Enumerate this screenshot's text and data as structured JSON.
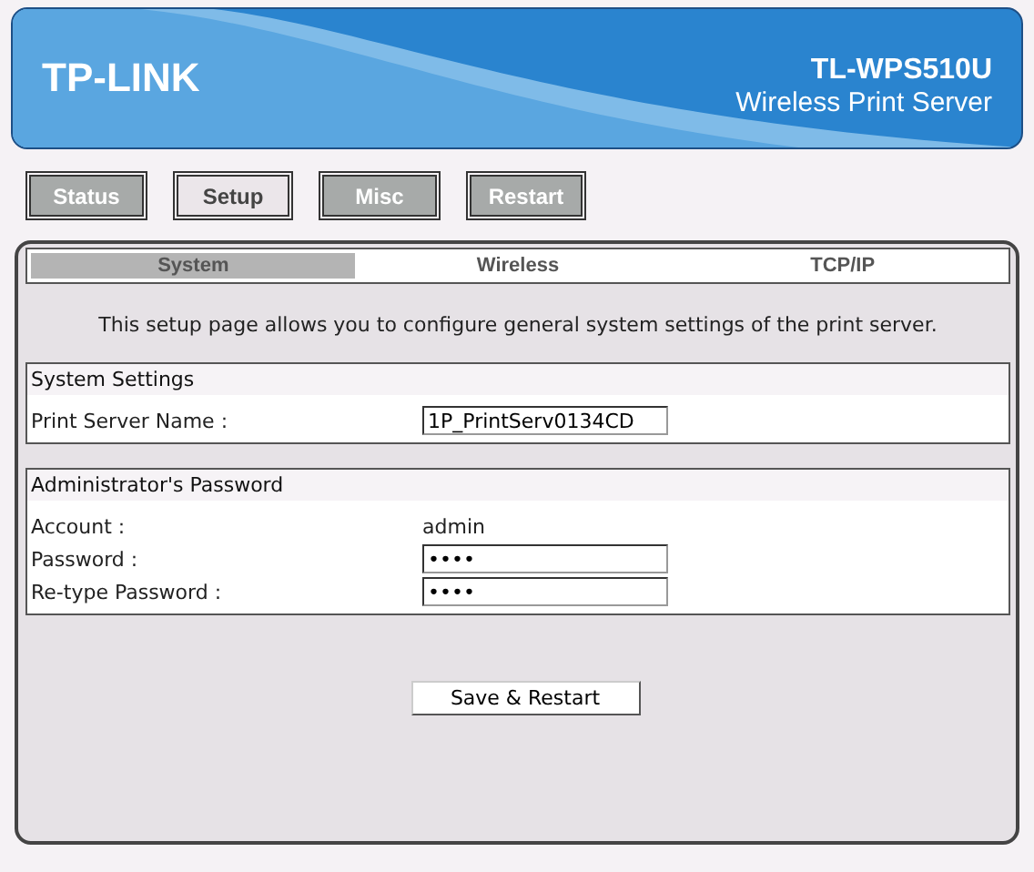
{
  "header": {
    "logo": "TP-LINK",
    "model": "TL-WPS510U",
    "subtitle": "Wireless Print Server"
  },
  "nav": [
    {
      "label": "Status",
      "selected": false
    },
    {
      "label": "Setup",
      "selected": true
    },
    {
      "label": "Misc",
      "selected": false
    },
    {
      "label": "Restart",
      "selected": false
    }
  ],
  "tabs": [
    {
      "label": "System",
      "selected": true
    },
    {
      "label": "Wireless",
      "selected": false
    },
    {
      "label": "TCP/IP",
      "selected": false
    }
  ],
  "description": "This setup page allows you to configure general system settings of the print server.",
  "sections": [
    {
      "title": "System Settings",
      "rows": [
        {
          "kind": "input",
          "label": "Print Server Name :",
          "value": "1P_PrintServ0134CD"
        }
      ]
    },
    {
      "title": "Administrator's Password",
      "rows": [
        {
          "kind": "text",
          "label": "Account :",
          "value": "admin"
        },
        {
          "kind": "input",
          "label": "Password :",
          "value": "••••"
        },
        {
          "kind": "input",
          "label": "Re-type Password :",
          "value": "••••"
        }
      ]
    }
  ],
  "save_button": "Save & Restart"
}
